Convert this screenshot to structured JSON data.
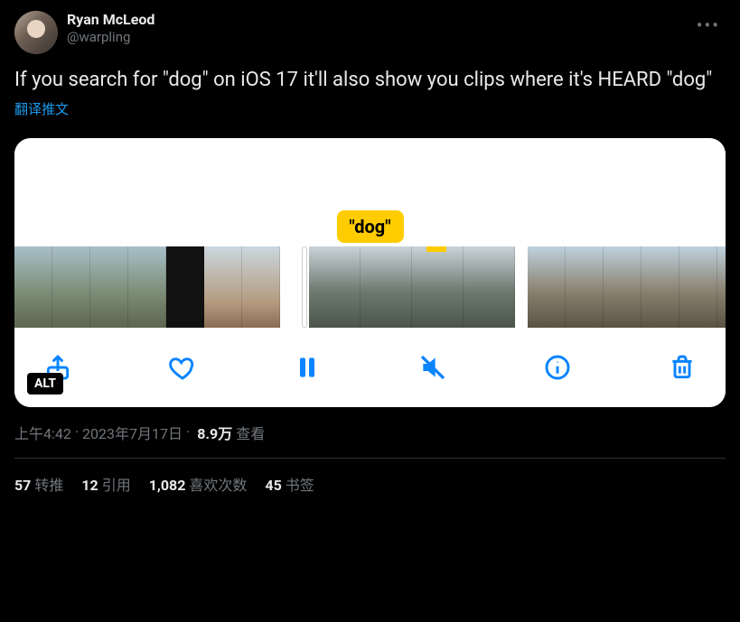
{
  "author": {
    "display_name": "Ryan McLeod",
    "handle": "@warpling"
  },
  "tweet_text": "If you search for \"dog\" on iOS 17 it'll also show you clips where it's HEARD \"dog\"",
  "translate_label": "翻译推文",
  "media": {
    "caption_tag": "\"dog\"",
    "alt_badge": "ALT",
    "toolbar_icons": {
      "share": "share-icon",
      "like": "heart-icon",
      "pause": "pause-icon",
      "mute": "mute-icon",
      "info": "info-icon",
      "trash": "trash-icon"
    }
  },
  "meta": {
    "time": "上午4:42",
    "dot1": " · ",
    "date": "2023年7月17日",
    "dot2": " · ",
    "views_count": "8.9万",
    "views_label": " 查看"
  },
  "stats": {
    "retweets_n": "57",
    "retweets_label": "转推",
    "quotes_n": "12",
    "quotes_label": "引用",
    "likes_n": "1,082",
    "likes_label": "喜欢次数",
    "bookmarks_n": "45",
    "bookmarks_label": "书签"
  }
}
